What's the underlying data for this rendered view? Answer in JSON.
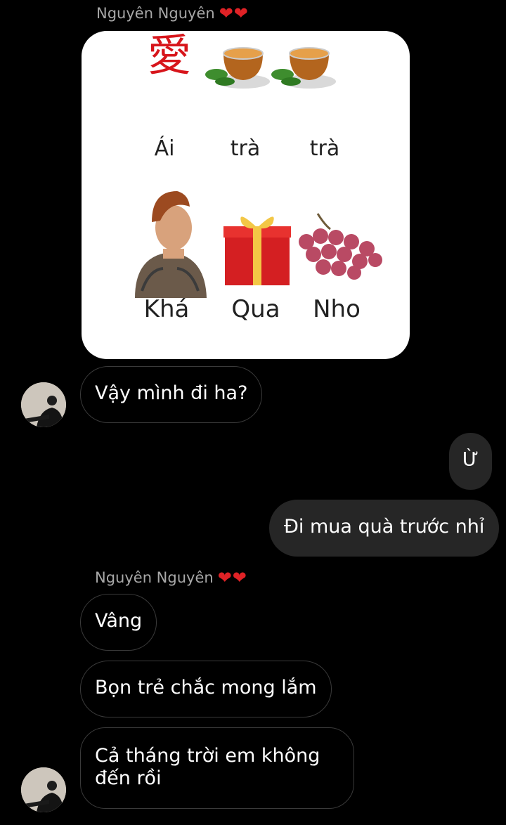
{
  "conversation": {
    "groups": [
      {
        "sender": "Nguyên Nguyên",
        "hearts": [
          "❤",
          "❤"
        ]
      },
      {
        "sender": "Nguyên Nguyên",
        "hearts": [
          "❤",
          "❤"
        ]
      }
    ],
    "image_message": {
      "hanzi": "愛",
      "row1": [
        "Ái",
        "trà",
        "trà"
      ],
      "row2": [
        "Khá",
        "Qua",
        "Nho"
      ]
    },
    "incoming_1": "Vậy mình đi ha?",
    "outgoing": [
      "Ừ",
      "Đi mua quà trước nhỉ"
    ],
    "incoming_2": [
      "Vâng",
      "Bọn trẻ chắc mong lắm",
      "Cả tháng trời em không đến rồi"
    ]
  },
  "colors": {
    "background": "#000000",
    "incoming_border": "#3a3a3a",
    "outgoing_bubble": "#262626",
    "sender_name": "#a7a7a7",
    "heart": "#e02226"
  },
  "icons": [
    "heart-icon",
    "avatar"
  ]
}
